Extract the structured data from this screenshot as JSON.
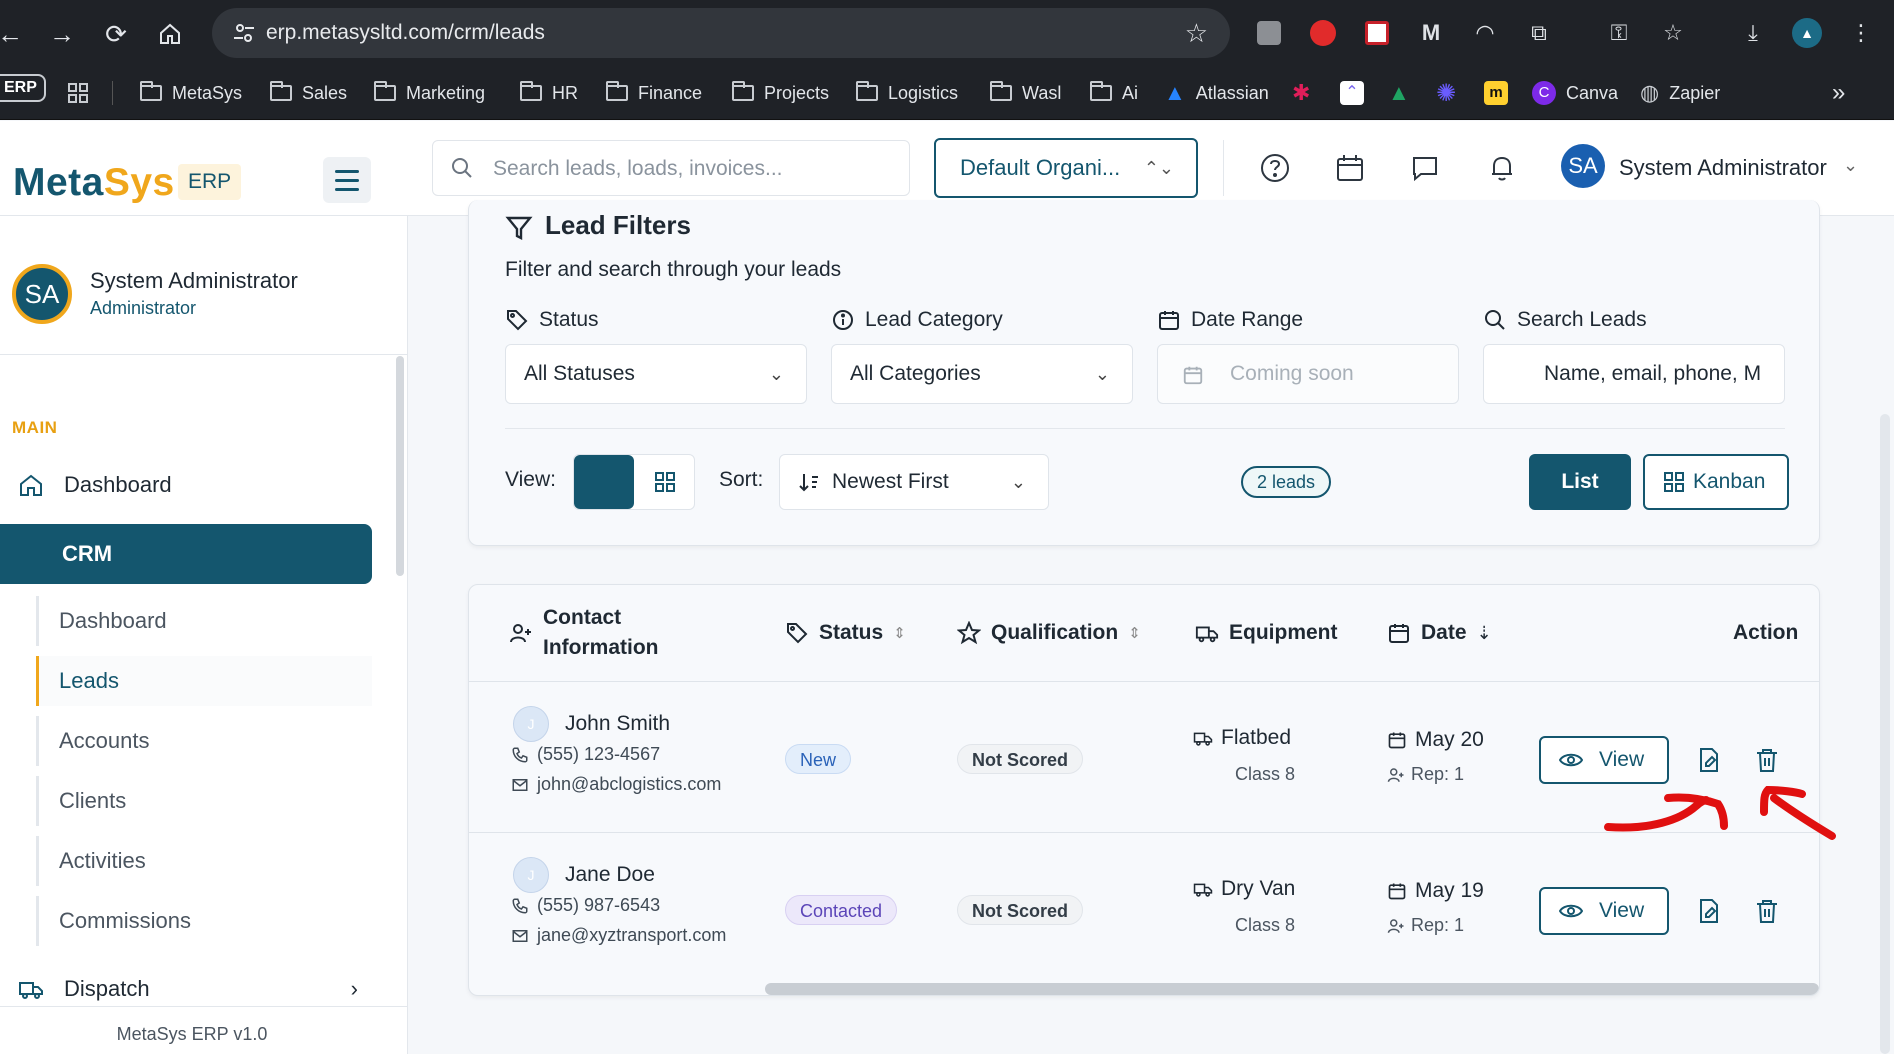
{
  "browser": {
    "url": "erp.metasysltd.com/crm/leads",
    "bookmarks": [
      {
        "label": "MetaSys"
      },
      {
        "label": "Sales"
      },
      {
        "label": "Marketing"
      },
      {
        "label": "HR"
      },
      {
        "label": "Finance"
      },
      {
        "label": "Projects"
      },
      {
        "label": "Logistics"
      },
      {
        "label": "Wasl"
      },
      {
        "label": "Ai"
      }
    ],
    "atlassian_label": "Atlassian",
    "canva_label": "Canva",
    "zapier_label": "Zapier",
    "erp_chip": "ERP",
    "more": "»"
  },
  "app": {
    "logo_meta": "Meta",
    "logo_sys": "Sys",
    "logo_badge": "ERP",
    "search_placeholder": "Search leads, loads, invoices...",
    "organization": "Default Organi...",
    "user_initials": "SA",
    "user_name": "System Administrator"
  },
  "sidebar": {
    "profile_initials": "SA",
    "profile_name": "System Administrator",
    "profile_role": "Administrator",
    "section_main": "MAIN",
    "dashboard": "Dashboard",
    "crm": "CRM",
    "crm_items": [
      "Dashboard",
      "Leads",
      "Accounts",
      "Clients",
      "Activities",
      "Commissions"
    ],
    "active_item": "Leads",
    "dispatch": "Dispatch",
    "version": "MetaSys ERP v1.0"
  },
  "filters": {
    "title": "Lead Filters",
    "subtitle": "Filter and search through your leads",
    "status_label": "Status",
    "status_value": "All Statuses",
    "category_label": "Lead Category",
    "category_value": "All Categories",
    "date_label": "Date Range",
    "date_value": "Coming soon",
    "search_label": "Search Leads",
    "search_value": "Name, email, phone, M",
    "view_label": "View:",
    "sort_label": "Sort:",
    "sort_value": "Newest First",
    "count_badge": "2 leads",
    "list_button": "List",
    "kanban_button": "Kanban"
  },
  "table": {
    "columns": {
      "contact_line1": "Contact",
      "contact_line2": "Information",
      "status": "Status",
      "qualification": "Qualification",
      "equipment": "Equipment",
      "date": "Date",
      "action": "Action"
    },
    "rows": [
      {
        "initial": "J",
        "name": "John Smith",
        "phone": "(555) 123-4567",
        "email": "john@abclogistics.com",
        "status": "New",
        "qualification": "Not Scored",
        "equipment": "Flatbed",
        "class": "Class 8",
        "date": "May 20",
        "rep": "Rep: 1",
        "view": "View"
      },
      {
        "initial": "J",
        "name": "Jane Doe",
        "phone": "(555) 987-6543",
        "email": "jane@xyztransport.com",
        "status": "Contacted",
        "qualification": "Not Scored",
        "equipment": "Dry Van",
        "class": "Class 8",
        "date": "May 19",
        "rep": "Rep: 1",
        "view": "View"
      }
    ]
  },
  "colors": {
    "primary": "#14566e",
    "accent": "#f0a71c",
    "annotation": "#e01010"
  }
}
